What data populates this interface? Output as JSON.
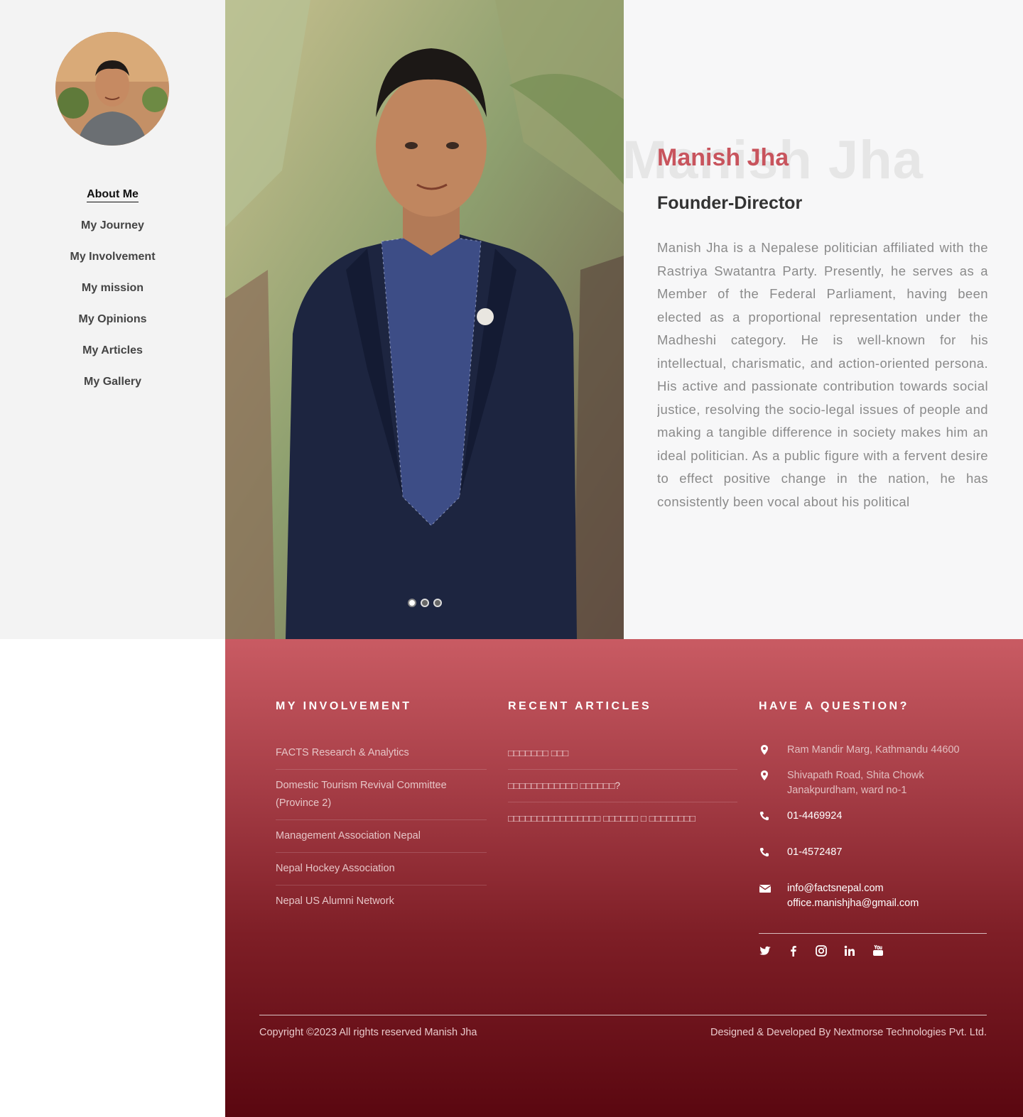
{
  "sidebar": {
    "nav": [
      {
        "label": "About Me",
        "active": true
      },
      {
        "label": "My Journey"
      },
      {
        "label": "My Involvement"
      },
      {
        "label": "My mission"
      },
      {
        "label": "My Opinions"
      },
      {
        "label": "My Articles"
      },
      {
        "label": "My Gallery"
      }
    ]
  },
  "hero": {
    "slides_count": 3,
    "active_slide": 1
  },
  "about": {
    "ghost_name": "Manish Jha",
    "name": "Manish Jha",
    "role": "Founder-Director",
    "bio": "Manish Jha is a Nepalese politician affiliated with the Rastriya Swatantra Party. Presently, he serves as a Member of the Federal Parliament, having been elected as a proportional representation under the Madheshi category. He is well-known for his intellectual, charismatic, and action-oriented persona. His active and passionate contribution towards social justice, resolving the socio-legal issues of people and making a tangible difference in society makes him an ideal politician. As a public figure with a fervent desire to effect positive change in the nation, he has consistently been vocal about his political",
    "accent_color": "#c8545d"
  },
  "footer": {
    "involvement": {
      "title": "MY INVOLVEMENT",
      "items": [
        "FACTS Research & Analytics",
        "Domestic Tourism Revival Committee (Province 2)",
        "Management Association Nepal",
        "Nepal Hockey Association",
        "Nepal US Alumni Network"
      ]
    },
    "articles": {
      "title": "RECENT ARTICLES",
      "items": [
        "□□□□□□□ □□□",
        "□□□□□□□□□□□□ □□□□□□?",
        "□□□□□□□□□□□□□□□□ □□□□□□ □ □□□□□□□□"
      ]
    },
    "contact": {
      "title": "HAVE A QUESTION?",
      "address1": "Ram Mandir Marg, Kathmandu 44600",
      "address2_line1": "Shivapath Road, Shita Chowk",
      "address2_line2": "Janakpurdham, ward no-1",
      "phone1": "01-4469924",
      "phone2": "01-4572487",
      "email1": "info@factsnepal.com",
      "email2": "office.manishjha@gmail.com",
      "icons": [
        "map-marker-icon",
        "map-marker-icon",
        "phone-icon",
        "phone-icon",
        "envelope-icon"
      ]
    },
    "socials": [
      "twitter-icon",
      "facebook-icon",
      "instagram-icon",
      "linkedin-icon",
      "youtube-icon"
    ],
    "copyright": "Copyright ©2023 All rights reserved Manish Jha",
    "credits": "Designed & Developed By Nextmorse Technologies Pvt. Ltd.",
    "gradient_top": "#c95b63",
    "gradient_bottom": "#5a0710"
  }
}
